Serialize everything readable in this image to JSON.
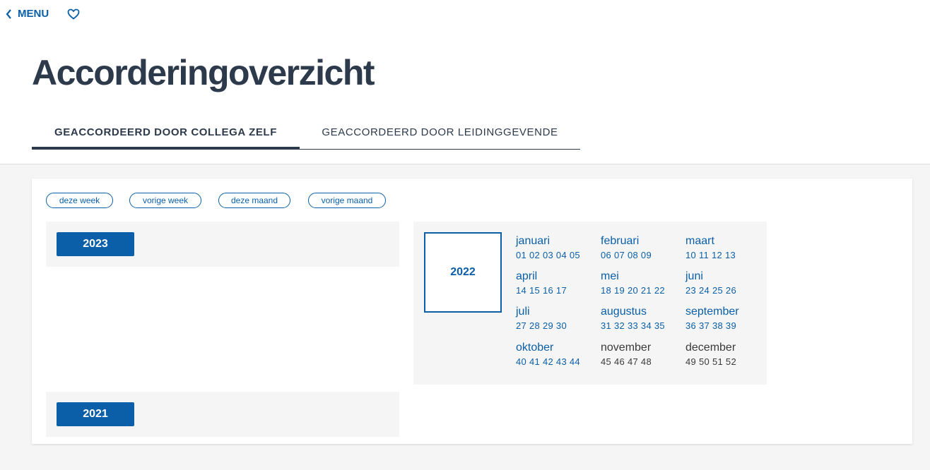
{
  "nav": {
    "menu_label": "MENU"
  },
  "page": {
    "title": "Accorderingoverzicht"
  },
  "tabs": [
    {
      "label": "GEACCORDEERD DOOR COLLEGA ZELF",
      "active": true
    },
    {
      "label": "GEACCORDEERD DOOR LEIDINGGEVENDE",
      "active": false
    }
  ],
  "filters": [
    "deze week",
    "vorige week",
    "deze maand",
    "vorige maand"
  ],
  "years": {
    "y2023": "2023",
    "y2022": "2022",
    "y2021": "2021"
  },
  "months_2022": [
    {
      "name": "januari",
      "weeks": "01 02 03 04 05",
      "linked": true
    },
    {
      "name": "februari",
      "weeks": "06 07 08 09",
      "linked": true
    },
    {
      "name": "maart",
      "weeks": "10 11 12 13",
      "linked": true
    },
    {
      "name": "april",
      "weeks": "14 15 16 17",
      "linked": true
    },
    {
      "name": "mei",
      "weeks": "18 19 20 21 22",
      "linked": true
    },
    {
      "name": "juni",
      "weeks": "23 24 25 26",
      "linked": true
    },
    {
      "name": "juli",
      "weeks": "27 28 29 30",
      "linked": true
    },
    {
      "name": "augustus",
      "weeks": "31 32 33 34 35",
      "linked": true
    },
    {
      "name": "september",
      "weeks": "36 37 38 39",
      "linked": true
    },
    {
      "name": "oktober",
      "weeks": "40 41 42 43 44",
      "linked": true
    },
    {
      "name": "november",
      "weeks": "45 46 47 48",
      "linked": false
    },
    {
      "name": "december",
      "weeks": "49 50 51 52",
      "linked": false
    }
  ],
  "colors": {
    "accent": "#0a5fa8",
    "title": "#2d3a4b",
    "panel": "#f5f5f5"
  },
  "icons": {
    "back": "chevron-left-icon",
    "favorite": "heart-icon"
  }
}
